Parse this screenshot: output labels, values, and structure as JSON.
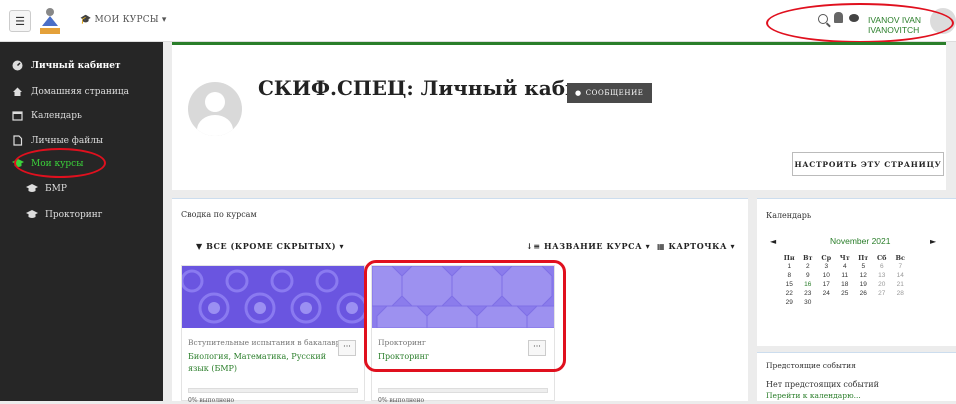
{
  "topbar": {
    "menu_icon": "☰",
    "mycourses_label": "МОИ КУРСЫ ▾",
    "username": "IVANOV IVAN IVANOVITCH"
  },
  "sidebar": {
    "items": [
      {
        "label": "Личный кабинет",
        "icon": "dashboard-icon"
      },
      {
        "label": "Домашняя страница",
        "icon": "home-icon"
      },
      {
        "label": "Календарь",
        "icon": "calendar-icon"
      },
      {
        "label": "Личные файлы",
        "icon": "file-icon"
      },
      {
        "label": "Мои курсы",
        "icon": "graduation-cap-icon"
      },
      {
        "label": "БМР",
        "icon": "graduation-cap-icon"
      },
      {
        "label": "Прокторинг",
        "icon": "graduation-cap-icon"
      }
    ]
  },
  "header": {
    "title": "СКИФ.СПЕЦ: Личный кабинет",
    "message_button": "СООБЩЕНИЕ",
    "customize_button": "НАСТРОИТЬ ЭТУ СТРАНИЦУ"
  },
  "overview": {
    "title": "Сводка по курсам",
    "filter_label": "▼ ВСЕ (КРОМЕ СКРЫТЫХ) ▾",
    "sort_label": "↓≡ НАЗВАНИЕ КУРСА ▾",
    "view_label": "▦ КАРТОЧКА ▾",
    "cards": [
      {
        "category": "Вступительные испытания в бакалаври...",
        "name": "Биология, Математика, Русский язык (БМР)",
        "menu": "···",
        "progress": "0% выполнено"
      },
      {
        "category": "Прокторинг",
        "name": "Прокторинг",
        "menu": "···",
        "progress": "0% выполнено"
      }
    ]
  },
  "calendar": {
    "title": "Календарь",
    "prev": "◄",
    "month": "November 2021",
    "next": "►",
    "weekdays": [
      "Пн",
      "Вт",
      "Ср",
      "Чт",
      "Пт",
      "Сб",
      "Вс"
    ],
    "weeks": [
      [
        "1",
        "2",
        "3",
        "4",
        "5",
        "6",
        "7"
      ],
      [
        "8",
        "9",
        "10",
        "11",
        "12",
        "13",
        "14"
      ],
      [
        "15",
        "16",
        "17",
        "18",
        "19",
        "20",
        "21"
      ],
      [
        "22",
        "23",
        "24",
        "25",
        "26",
        "27",
        "28"
      ],
      [
        "29",
        "30",
        "",
        "",
        "",
        "",
        ""
      ]
    ]
  },
  "events": {
    "title": "Предстоящие события",
    "empty": "Нет предстоящих событий",
    "link": "Перейти к календарю..."
  },
  "colors": {
    "accent": "#2a7e2a",
    "sidebar_bg": "#262626",
    "highlight": "#e0101e",
    "card_bg": "#6a55e0"
  }
}
